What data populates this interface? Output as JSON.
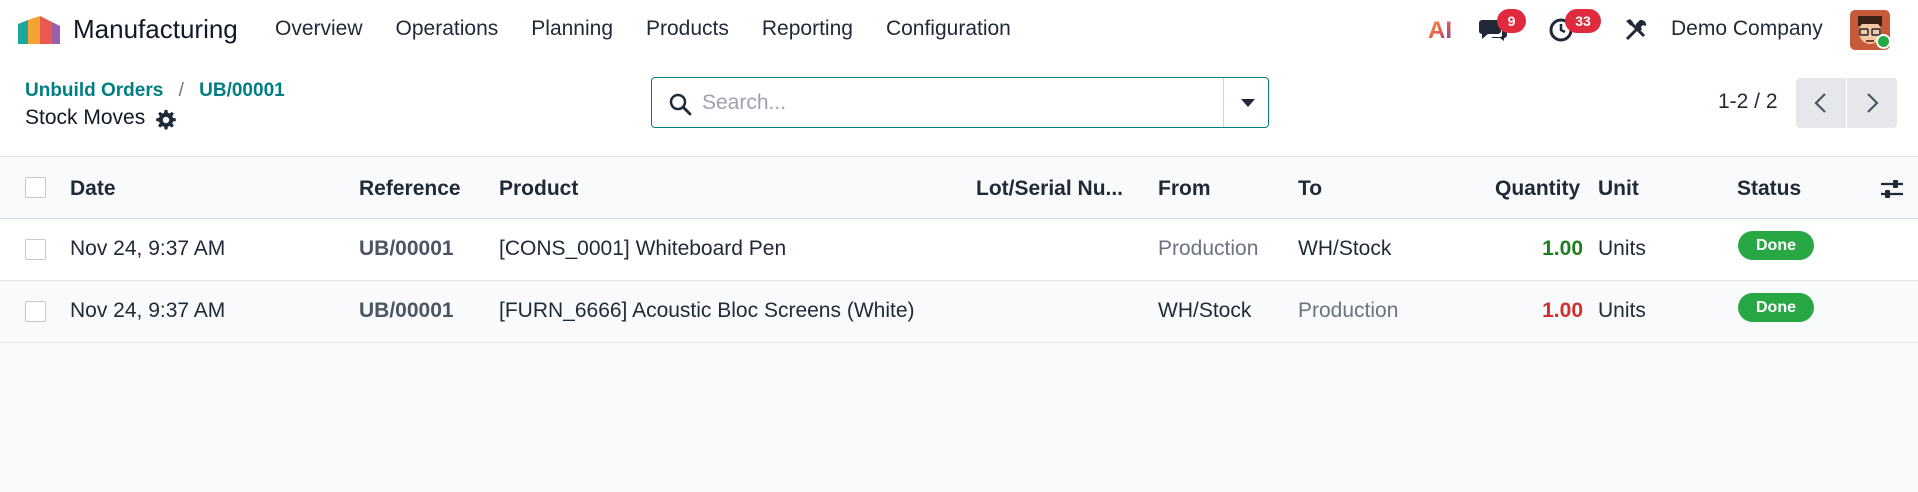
{
  "navbar": {
    "app_name": "Manufacturing",
    "menu": [
      "Overview",
      "Operations",
      "Planning",
      "Products",
      "Reporting",
      "Configuration"
    ],
    "ai_label": "AI",
    "messages_count": "9",
    "activities_count": "33",
    "company": "Demo Company"
  },
  "control_panel": {
    "breadcrumb": [
      "Unbuild Orders",
      "UB/00001"
    ],
    "breadcrumb_sep": "/",
    "title": "Stock Moves",
    "search_placeholder": "Search...",
    "pager": "1-2 / 2"
  },
  "table": {
    "headers": {
      "date": "Date",
      "reference": "Reference",
      "product": "Product",
      "lot": "Lot/Serial Nu...",
      "from": "From",
      "to": "To",
      "quantity": "Quantity",
      "unit": "Unit",
      "status": "Status"
    },
    "rows": [
      {
        "date": "Nov 24, 9:37 AM",
        "reference": "UB/00001",
        "product": "[CONS_0001] Whiteboard Pen",
        "lot": "",
        "from": "Production",
        "to": "WH/Stock",
        "quantity": "1.00",
        "unit": "Units",
        "status": "Done"
      },
      {
        "date": "Nov 24, 9:37 AM",
        "reference": "UB/00001",
        "product": "[FURN_6666] Acoustic Bloc Screens (White)",
        "lot": "",
        "from": "WH/Stock",
        "to": "Production",
        "quantity": "1.00",
        "unit": "Units",
        "status": "Done"
      }
    ]
  },
  "colors": {
    "accent": "#017e84",
    "done": "#28a745",
    "qty_in": "#1e7d1e",
    "qty_out": "#d12e2e",
    "badge": "#e02a3d"
  }
}
